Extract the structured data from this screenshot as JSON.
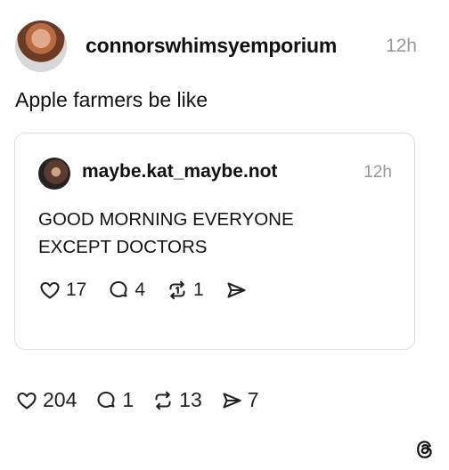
{
  "post": {
    "username": "connorswhimsyemporium",
    "time": "12h",
    "text": "Apple farmers be like",
    "actions": {
      "likes": "204",
      "replies": "1",
      "reposts": "13",
      "shares": "7"
    }
  },
  "quote": {
    "username": "maybe.kat_maybe.not",
    "time": "12h",
    "text_lines": [
      "GOOD MORNING EVERYONE",
      "EXCEPT DOCTORS"
    ],
    "actions": {
      "likes": "17",
      "replies": "4",
      "reposts": "1"
    }
  },
  "icons": [
    "heart-icon",
    "comment-icon",
    "repost-icon",
    "share-icon",
    "threads-logo-icon"
  ]
}
